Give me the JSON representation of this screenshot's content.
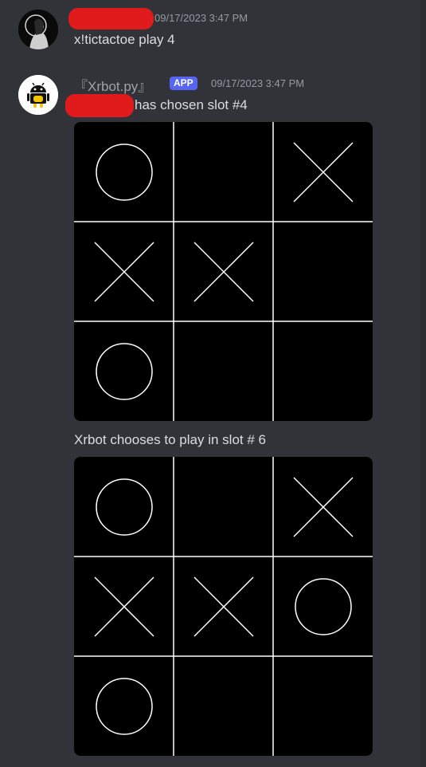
{
  "messages": [
    {
      "author_redacted": true,
      "timestamp": "09/17/2023 3:47 PM",
      "content": "x!tictactoe play 4"
    },
    {
      "author": "『Xrbot.py』",
      "badge": "APP",
      "timestamp": "09/17/2023 3:47 PM",
      "content_suffix": "has chosen slot #4",
      "board1": [
        "O",
        "",
        "X",
        "X",
        "X",
        "",
        "O",
        "",
        ""
      ],
      "between_text": "Xrbot chooses to play in slot # 6",
      "board2": [
        "O",
        "",
        "X",
        "X",
        "X",
        "O",
        "O",
        "",
        ""
      ]
    }
  ],
  "colors": {
    "background": "#313338",
    "redaction": "#e11b1b",
    "app_badge": "#5865f2",
    "board_bg": "#000000",
    "board_lines": "#ffffff"
  },
  "icons": {
    "user_avatar": "avatar-user",
    "bot_avatar": "android-robot-icon"
  }
}
